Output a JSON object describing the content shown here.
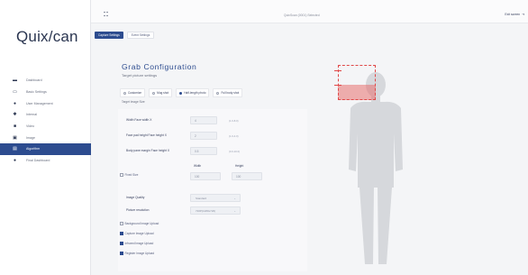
{
  "brand": {
    "logo_left": "Quix",
    "logo_mark": "/",
    "logo_right": "can"
  },
  "topbar": {
    "device": "QuixScan (0001) Selected",
    "exit_label": "Exit screen"
  },
  "sidebar": {
    "items": [
      {
        "label": "Dashboard",
        "icon": "dashboard-icon",
        "glyph": "▬"
      },
      {
        "label": "Basic Settings",
        "icon": "monitor-icon",
        "glyph": "▭"
      },
      {
        "label": "User Management",
        "icon": "user-icon",
        "glyph": "●"
      },
      {
        "label": "Internal",
        "icon": "gear-icon",
        "glyph": "✱"
      },
      {
        "label": "Video",
        "icon": "video-icon",
        "glyph": "■"
      },
      {
        "label": "Image",
        "icon": "image-icon",
        "glyph": "▣"
      },
      {
        "label": "Algorithm",
        "icon": "algorithm-icon",
        "glyph": "▤"
      },
      {
        "label": "Final Dashboard",
        "icon": "circle-icon",
        "glyph": "●"
      }
    ],
    "active_index": 6
  },
  "tabs": [
    {
      "label": "Capture Settings"
    },
    {
      "label": "Event Settings"
    }
  ],
  "grab": {
    "title": "Grab Configuration",
    "subtitle": "Target picture settings",
    "options": [
      "Customize",
      "Mug shot",
      "Half-length photo",
      "Full body shot"
    ],
    "selected_option": 2,
    "target_size_label": "Target Image Size",
    "fields": [
      {
        "label": "Width   Face width  X",
        "value": "4",
        "hint": "(1.0-8.0)"
      },
      {
        "label": "Face pad height   Face height  X",
        "value": "2",
        "hint": "(1.0-4.0)"
      },
      {
        "label": "Body pane margin   Face height  X",
        "value": "0.5",
        "hint": "(0.0-10.0)"
      }
    ],
    "fixed_size": {
      "label": "Fixed Size",
      "width_head": "Width",
      "height_head": "Height",
      "width_value": "100",
      "height_value": "100"
    },
    "image_quality": {
      "label": "Image Quality",
      "value": "Standard"
    },
    "resolution": {
      "label": "Picture resolution",
      "value": "720P(1280x720)"
    },
    "uploads": [
      {
        "label": "Background Image Upload",
        "checked": false
      },
      {
        "label": "Capture Image Upload",
        "checked": true
      },
      {
        "label": "Infrared Image Upload",
        "checked": true
      },
      {
        "label": "Register Image Upload",
        "checked": true
      }
    ]
  },
  "colors": {
    "accent": "#2d4c8f",
    "overlay": "#e04848",
    "silhouette": "#d6d8dc"
  }
}
